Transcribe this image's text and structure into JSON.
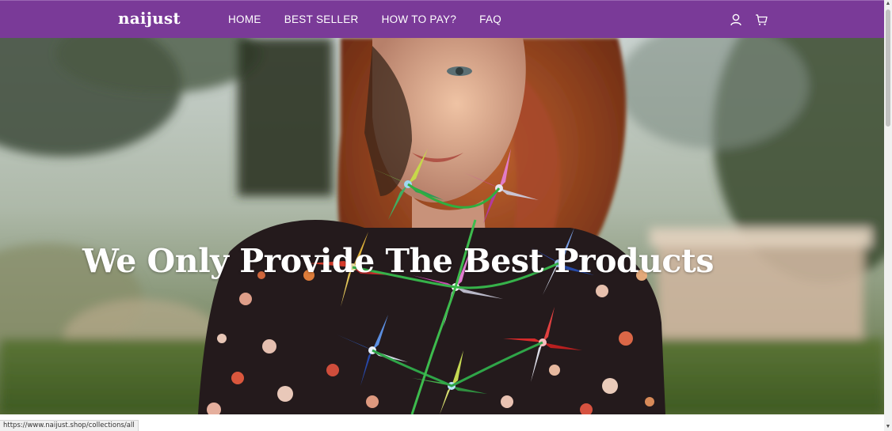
{
  "header": {
    "logo_text": "naijust",
    "background_color": "#7a3a98",
    "nav": [
      {
        "label": "HOME"
      },
      {
        "label": "BEST SELLER"
      },
      {
        "label": "HOW TO PAY?"
      },
      {
        "label": "FAQ"
      }
    ],
    "icons": [
      "user-icon",
      "cart-icon"
    ]
  },
  "hero": {
    "title": "We Only Provide The Best Products",
    "image_subject": "woman-with-pinwheels-photo"
  },
  "status_bar": {
    "url": "https://www.naijust.shop/collections/all"
  }
}
